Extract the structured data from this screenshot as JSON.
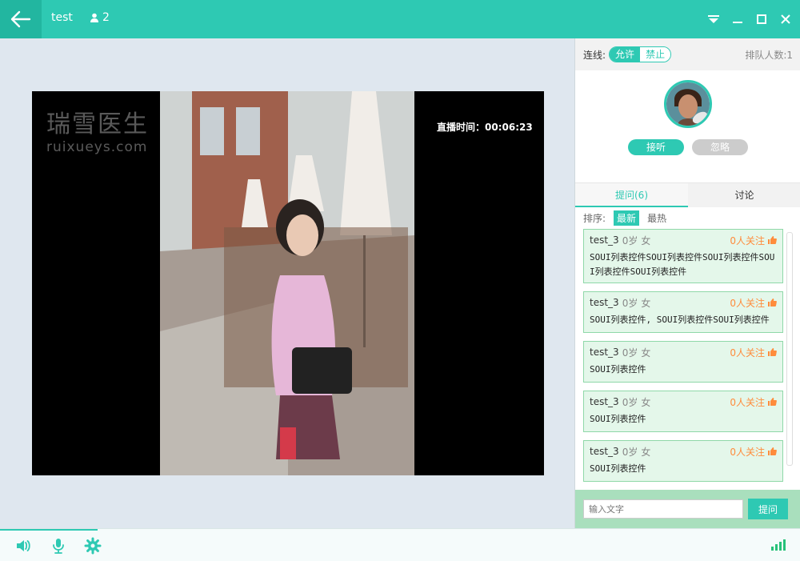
{
  "window": {
    "title": "test",
    "user_count": "2"
  },
  "video": {
    "watermark_cn": "瑞雪医生",
    "watermark_url": "ruixueys.com",
    "live_time": "直播时间：00:06:23"
  },
  "connect": {
    "label": "连线:",
    "allow": "允许",
    "deny": "禁止",
    "queue": "排队人数:1"
  },
  "caller": {
    "accept": "接听",
    "ignore": "忽略"
  },
  "tabs": [
    {
      "label": "提问(6)"
    },
    {
      "label": "讨论"
    }
  ],
  "sort": {
    "label": "排序:",
    "newest": "最新",
    "hottest": "最热"
  },
  "questions": [
    {
      "user": "test_3",
      "age": "0岁",
      "gender": "女",
      "follow": "0人关注",
      "text": "SOUI列表控件SOUI列表控件SOUI列表控件SOUI列表控件SOUI列表控件"
    },
    {
      "user": "test_3",
      "age": "0岁",
      "gender": "女",
      "follow": "0人关注",
      "text": "SOUI列表控件, SOUI列表控件SOUI列表控件"
    },
    {
      "user": "test_3",
      "age": "0岁",
      "gender": "女",
      "follow": "0人关注",
      "text": "SOUI列表控件"
    },
    {
      "user": "test_3",
      "age": "0岁",
      "gender": "女",
      "follow": "0人关注",
      "text": "SOUI列表控件"
    },
    {
      "user": "test_3",
      "age": "0岁",
      "gender": "女",
      "follow": "0人关注",
      "text": "SOUI列表控件"
    }
  ],
  "ask": {
    "placeholder": "输入文字",
    "button": "提问"
  },
  "colors": {
    "accent": "#2ec9b3",
    "card_bg": "#e4f7ea",
    "follow": "#ff8c3c"
  }
}
